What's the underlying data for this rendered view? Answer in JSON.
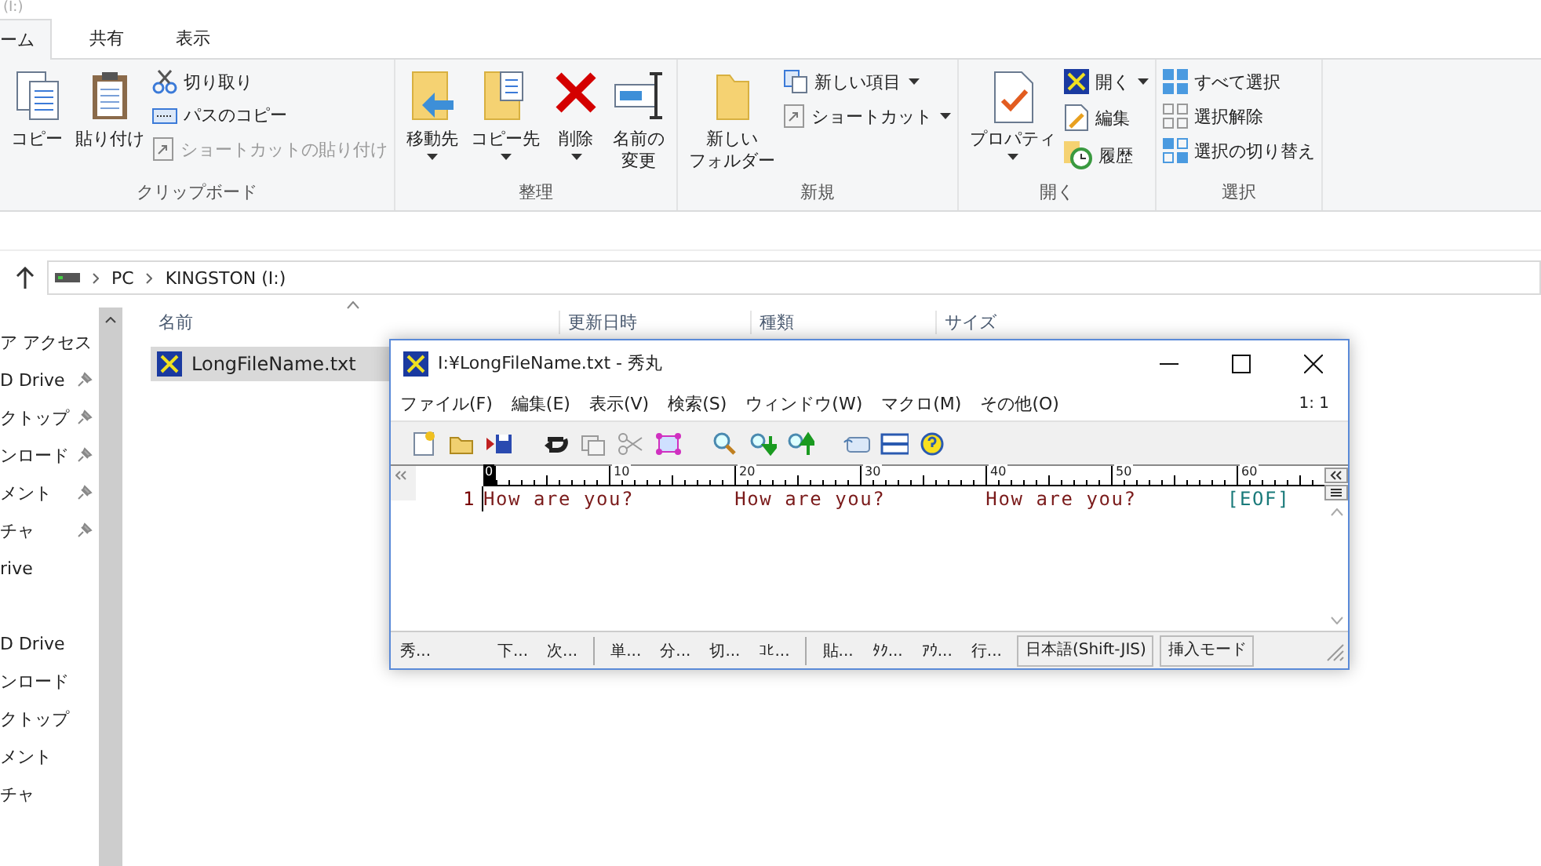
{
  "explorer": {
    "title": "(I:)",
    "tabs": [
      {
        "label": "ーム",
        "selected": true
      },
      {
        "label": "共有",
        "selected": false
      },
      {
        "label": "表示",
        "selected": false
      }
    ],
    "ribbon": [
      {
        "name": "クリップボード",
        "large": [
          {
            "lines": [
              "コピー"
            ],
            "dropdown": false
          },
          {
            "lines": [
              "貼り付け"
            ],
            "dropdown": false
          }
        ],
        "small": [
          {
            "label": "切り取り",
            "disabled": false,
            "dropdown": false
          },
          {
            "label": "パスのコピー",
            "disabled": false,
            "dropdown": false
          },
          {
            "label": "ショートカットの貼り付け",
            "disabled": true,
            "dropdown": false
          }
        ]
      },
      {
        "name": "整理",
        "large": [
          {
            "lines": [
              "移動先"
            ],
            "dropdown": true
          },
          {
            "lines": [
              "コピー先"
            ],
            "dropdown": true
          },
          {
            "lines": [
              "削除"
            ],
            "dropdown": true
          },
          {
            "lines": [
              "名前の",
              "変更"
            ],
            "dropdown": false
          }
        ]
      },
      {
        "name": "新規",
        "large": [
          {
            "lines": [
              "新しい",
              "フォルダー"
            ],
            "dropdown": false
          }
        ],
        "small": [
          {
            "label": "新しい項目",
            "disabled": false,
            "dropdown": true
          },
          {
            "label": "ショートカット",
            "disabled": false,
            "dropdown": true
          }
        ]
      },
      {
        "name": "開く",
        "large": [
          {
            "lines": [
              "プロパティ"
            ],
            "dropdown": true
          }
        ],
        "small": [
          {
            "label": "開く",
            "disabled": false,
            "dropdown": true
          },
          {
            "label": "編集",
            "disabled": false,
            "dropdown": false
          },
          {
            "label": "履歴",
            "disabled": false,
            "dropdown": false
          }
        ]
      },
      {
        "name": "選択",
        "small": [
          {
            "label": "すべて選択",
            "disabled": false,
            "dropdown": false
          },
          {
            "label": "選択解除",
            "disabled": false,
            "dropdown": false
          },
          {
            "label": "選択の切り替え",
            "disabled": false,
            "dropdown": false
          }
        ]
      }
    ],
    "breadcrumb": [
      "PC",
      "KINGSTON (I:)"
    ],
    "nav": [
      [
        {
          "label": "ア アクセス",
          "pinned": false
        },
        {
          "label": "D Drive",
          "pinned": true
        },
        {
          "label": "クトップ",
          "pinned": true
        },
        {
          "label": "ンロード",
          "pinned": true
        },
        {
          "label": "メント",
          "pinned": true
        },
        {
          "label": "チャ",
          "pinned": true
        },
        {
          "label": "rive",
          "pinned": false
        }
      ],
      [
        {
          "label": "D Drive",
          "pinned": false
        },
        {
          "label": "ンロード",
          "pinned": false
        },
        {
          "label": "クトップ",
          "pinned": false
        },
        {
          "label": "メント",
          "pinned": false
        },
        {
          "label": "チャ",
          "pinned": false
        }
      ]
    ],
    "columns": [
      "名前",
      "更新日時",
      "種類",
      "サイズ"
    ],
    "files": [
      {
        "name": "LongFileName.txt",
        "selected": true
      }
    ]
  },
  "editor": {
    "title": "I:¥LongFileName.txt - 秀丸",
    "menu": [
      "ファイル(F)",
      "編集(E)",
      "表示(V)",
      "検索(S)",
      "ウィンドウ(W)",
      "マクロ(M)",
      "その他(O)"
    ],
    "position": "1: 1",
    "ruler": [
      "0",
      "10",
      "20",
      "30",
      "40",
      "50",
      "60"
    ],
    "lines": [
      {
        "number": "1",
        "text": "How are you?        How are you?        How are you?",
        "eof": "[EOF]"
      }
    ],
    "status": [
      {
        "kind": "button",
        "label": "秀..."
      },
      {
        "kind": "button",
        "label": "下..."
      },
      {
        "kind": "button",
        "label": "次..."
      },
      {
        "kind": "separator"
      },
      {
        "kind": "button",
        "label": "単..."
      },
      {
        "kind": "button",
        "label": "分..."
      },
      {
        "kind": "button",
        "label": "切..."
      },
      {
        "kind": "button",
        "label": "ｺﾋ..."
      },
      {
        "kind": "separator"
      },
      {
        "kind": "button",
        "label": "貼..."
      },
      {
        "kind": "button",
        "label": "ﾀｸ..."
      },
      {
        "kind": "button",
        "label": "ｱｳ..."
      },
      {
        "kind": "button",
        "label": "行..."
      },
      {
        "kind": "field",
        "label": "日本語(Shift-JIS)"
      },
      {
        "kind": "field",
        "label": "挿入モード"
      }
    ]
  }
}
